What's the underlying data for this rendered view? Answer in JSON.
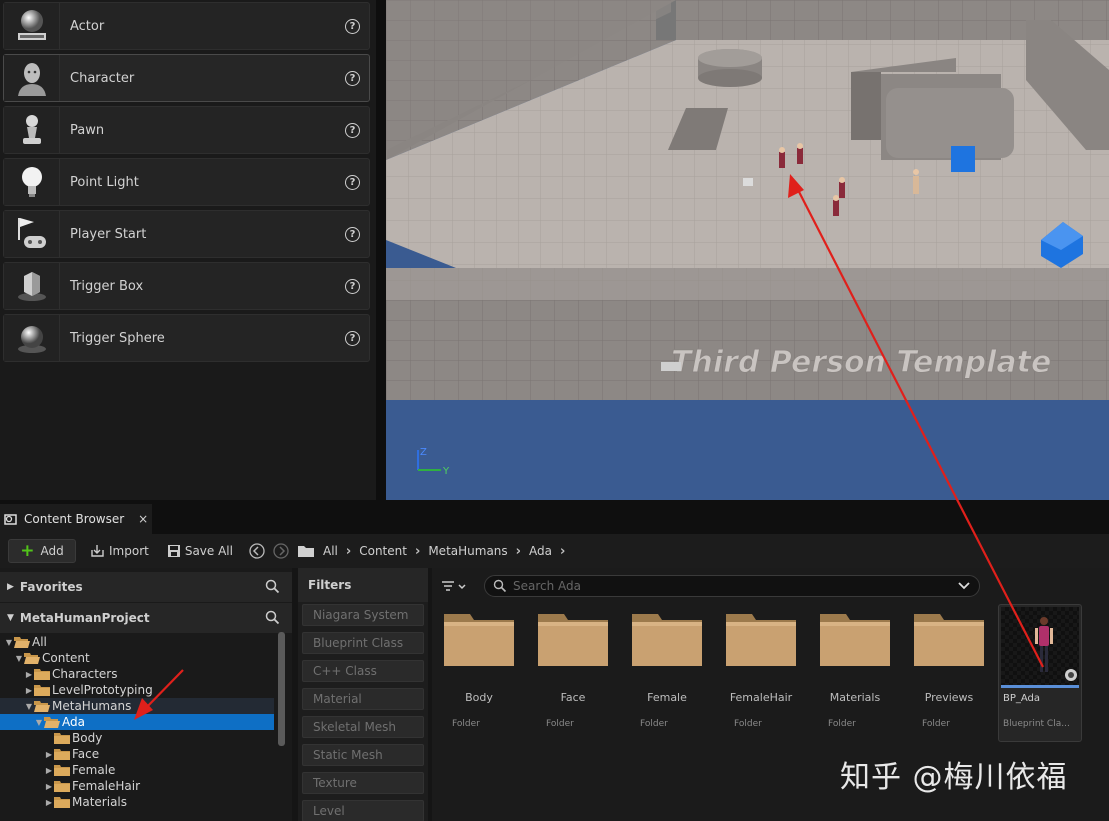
{
  "place_actors": {
    "items": [
      {
        "label": "Actor",
        "icon": "sphere-pedestal-icon"
      },
      {
        "label": "Character",
        "icon": "character-bust-icon"
      },
      {
        "label": "Pawn",
        "icon": "pawn-icon"
      },
      {
        "label": "Point Light",
        "icon": "lightbulb-icon"
      },
      {
        "label": "Player Start",
        "icon": "flag-gamepad-icon"
      },
      {
        "label": "Trigger Box",
        "icon": "cube-icon"
      },
      {
        "label": "Trigger Sphere",
        "icon": "sphere-icon"
      }
    ],
    "help_glyph": "?"
  },
  "viewport": {
    "text": "Third Person Template",
    "gizmo_z": "Z",
    "gizmo_y": "Y",
    "colors": {
      "floor": "#b9b2ad",
      "wall": "#8e8986",
      "water": "#3a5b91",
      "cube": "#1e74e0"
    }
  },
  "content_browser": {
    "tab_title": "Content Browser",
    "tab_close": "×",
    "toolbar": {
      "add": "Add",
      "import": "Import",
      "save_all": "Save All"
    },
    "breadcrumb": [
      "All",
      "Content",
      "MetaHumans",
      "Ada"
    ],
    "favorites": "Favorites",
    "project": "MetaHumanProject",
    "tree": [
      {
        "label": "All",
        "indent": 0,
        "arrow": "▼"
      },
      {
        "label": "Content",
        "indent": 1,
        "arrow": "▼"
      },
      {
        "label": "Characters",
        "indent": 2,
        "arrow": "▶"
      },
      {
        "label": "LevelPrototyping",
        "indent": 2,
        "arrow": "▶"
      },
      {
        "label": "MetaHumans",
        "indent": 2,
        "arrow": "▼"
      },
      {
        "label": "Ada",
        "indent": 3,
        "arrow": "▼",
        "selected": true
      },
      {
        "label": "Body",
        "indent": 4,
        "arrow": ""
      },
      {
        "label": "Face",
        "indent": 4,
        "arrow": "▶"
      },
      {
        "label": "Female",
        "indent": 4,
        "arrow": "▶"
      },
      {
        "label": "FemaleHair",
        "indent": 4,
        "arrow": "▶"
      },
      {
        "label": "Materials",
        "indent": 4,
        "arrow": "▶"
      }
    ],
    "filters_title": "Filters",
    "filters": [
      "Niagara System",
      "Blueprint Class",
      "C++ Class",
      "Material",
      "Skeletal Mesh",
      "Static Mesh",
      "Texture",
      "Level"
    ],
    "search_placeholder": "Search Ada",
    "assets": [
      {
        "name": "Body",
        "type": "Folder"
      },
      {
        "name": "Face",
        "type": "Folder"
      },
      {
        "name": "Female",
        "type": "Folder"
      },
      {
        "name": "FemaleHair",
        "type": "Folder"
      },
      {
        "name": "Materials",
        "type": "Folder"
      },
      {
        "name": "Previews",
        "type": "Folder"
      }
    ],
    "blueprint": {
      "name": "BP_Ada",
      "type": "Blueprint Cla..."
    }
  },
  "watermark": "知乎 @梅川依福",
  "annotation_color": "#e0201b"
}
